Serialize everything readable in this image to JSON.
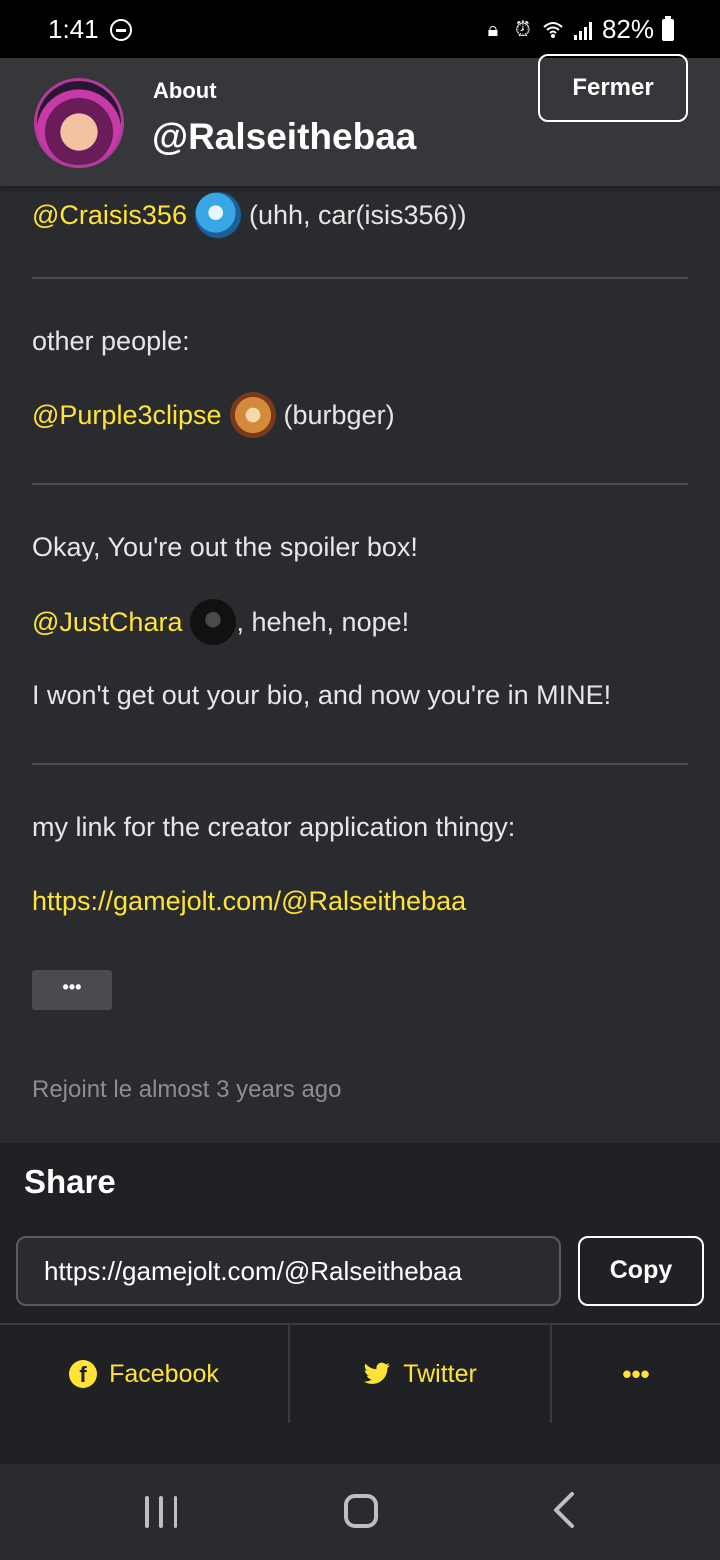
{
  "status_bar": {
    "time": "1:41",
    "battery": "82%"
  },
  "header": {
    "label": "About",
    "title": "@Ralseithebaa",
    "close_label": "Fermer"
  },
  "bio": {
    "line1": {
      "mention": "@Craisis356",
      "text": "(uhh, car(isis356))"
    },
    "line2": {
      "text": "other people:"
    },
    "line3": {
      "mention": "@Purple3clipse",
      "text": "(burbger)"
    },
    "line4": {
      "text": "Okay, You're out the spoiler box!"
    },
    "line5": {
      "mention": "@JustChara",
      "text": ", heheh, nope!"
    },
    "line6": {
      "text": "I won't get out your bio, and now you're in MINE!"
    },
    "line7": {
      "text": "my link for the creator application thingy:"
    },
    "line8": {
      "link": "https://gamejolt.com/@Ralseithebaa"
    },
    "more_label": "•••",
    "joined": "Rejoint le almost 3 years ago"
  },
  "share": {
    "title": "Share",
    "url": "https://gamejolt.com/@Ralseithebaa",
    "copy_label": "Copy",
    "facebook_label": "Facebook",
    "twitter_label": "Twitter",
    "more_label": "•••"
  },
  "colors": {
    "accent": "#ffe336",
    "background": "#2a2b2f",
    "header": "#36373b",
    "share_panel": "#202124"
  }
}
